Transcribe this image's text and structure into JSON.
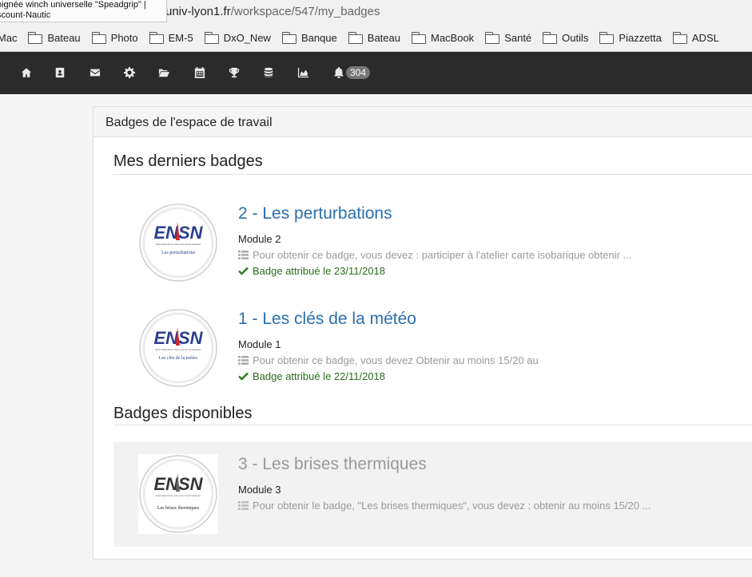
{
  "browser": {
    "url_host": "univ-lyon1.fr",
    "url_path": "/workspace/547/my_badges",
    "tooltip_line1": "oignée winch universelle \"Speadgrip\" |",
    "tooltip_line2": "scount-Nautic",
    "bookmarks": [
      "iMac",
      "Bateau",
      "Photo",
      "EM-5",
      "DxO_New",
      "Banque",
      "Bateau",
      "MacBook",
      "Santé",
      "Outils",
      "Piazzetta",
      "ADSL"
    ]
  },
  "navbar": {
    "icons": [
      "home-icon",
      "contacts-icon",
      "envelope-icon",
      "gear-icon",
      "folder-open-icon",
      "calendar-icon",
      "trophy-icon",
      "database-icon",
      "area-chart-icon",
      "bell-icon"
    ],
    "notification_count": "304"
  },
  "panel": {
    "heading": "Badges de l'espace de travail",
    "recent_title": "Mes derniers badges",
    "available_title": "Badges disponibles"
  },
  "badges": [
    {
      "title": "2 - Les perturbations",
      "module": "Module 2",
      "description": "Pour obtenir ce badge, vous devez : participer à l'atelier carte isobarique obtenir ...",
      "awarded": "Badge attribué le 23/11/2018",
      "image_caption": "Les perturbations",
      "image_logo": "ENSN",
      "image_subtitle": "Ecole Nationale de Voile et des Sports Nautiques"
    },
    {
      "title": "1 - Les clés de la météo",
      "module": "Module 1",
      "description": "Pour obtenir ce badge, vous devez Obtenir au moins 15/20 au",
      "awarded": "Badge attribué le 22/11/2018",
      "image_caption": "Les clés de la météo",
      "image_logo": "ENSN",
      "image_subtitle": "Ecole Nationale de Voile et des Sports Nautiques"
    },
    {
      "title": "3 - Les brises thermiques",
      "module": "Module 3",
      "description": "Pour obtenir le badge, \"Les brises thermiques\", vous devez : obtenir au moins 15/20 ...",
      "image_caption": "Les brises thermiques",
      "image_logo": "ENSN",
      "image_subtitle": "Ecole Nationale de Voile et des Sports Nautiques"
    }
  ],
  "colors": {
    "navbar_bg": "#2b2b2b",
    "link_blue": "#2a6fb0",
    "awarded_green": "#2e6b1f",
    "muted_gray": "#9a9a9a"
  }
}
